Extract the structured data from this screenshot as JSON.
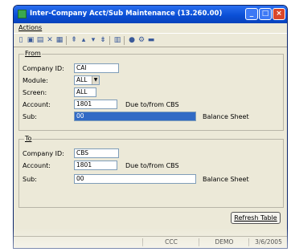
{
  "window": {
    "title": "Inter-Company Acct/Sub Maintenance (13.260.00)"
  },
  "menu": {
    "actions": "Actions"
  },
  "toolbar_icons": [
    "new-icon",
    "save-icon",
    "copy-icon",
    "delete-icon",
    "paste-icon",
    "first-icon",
    "previous-icon",
    "next-icon",
    "last-icon",
    "calendar-icon",
    "help-icon",
    "settings-icon",
    "screen-icon"
  ],
  "from": {
    "label": "From",
    "company_label": "Company ID:",
    "company": "CAI",
    "module_label": "Module:",
    "module": "ALL",
    "screen_label": "Screen:",
    "screen": "ALL",
    "account_label": "Account:",
    "account": "1801",
    "account_desc": "Due to/from CBS",
    "sub_label": "Sub:",
    "sub": "00",
    "sub_desc": "Balance Sheet"
  },
  "to": {
    "label": "To",
    "company_label": "Company ID:",
    "company": "CBS",
    "account_label": "Account:",
    "account": "1801",
    "account_desc": "Due to/from CBS",
    "sub_label": "Sub:",
    "sub": "00",
    "sub_desc": "Balance Sheet"
  },
  "refresh_button": "Refresh Table",
  "status": {
    "company": "CCC",
    "database": "DEMO",
    "date": "3/6/2005"
  },
  "colors": {
    "titlebar": "#0a4fd6",
    "window_bg": "#ece9d8",
    "selection": "#316ac5"
  }
}
